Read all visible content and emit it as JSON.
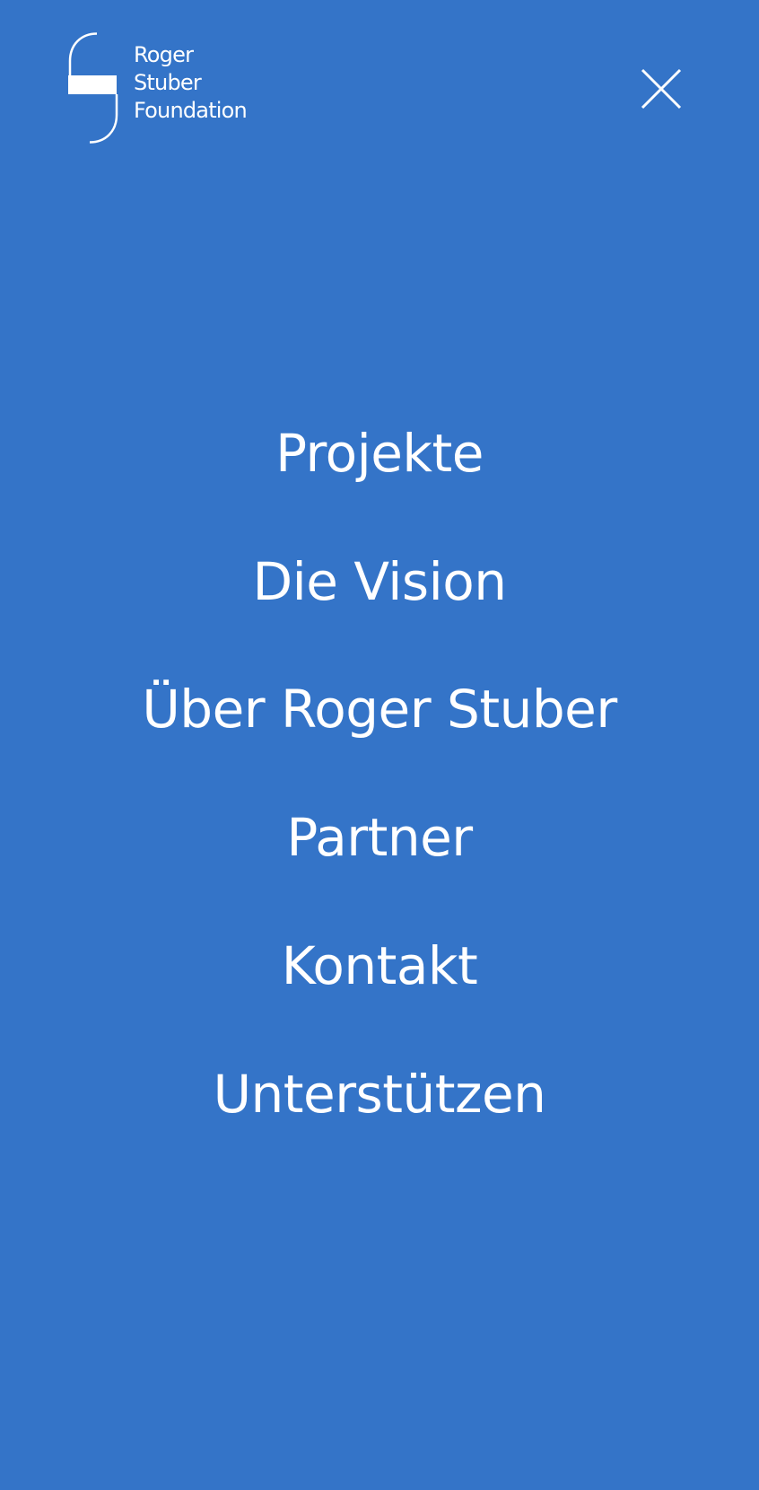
{
  "theme": {
    "background": "#3474c8",
    "foreground": "#ffffff"
  },
  "header": {
    "logo": {
      "line1": "Roger",
      "line2": "Stuber",
      "line3": "Foundation",
      "icon": "foundation-s-mark-icon"
    },
    "close": {
      "icon": "close-icon",
      "label": ""
    }
  },
  "menu": {
    "items": [
      {
        "label": "Projekte"
      },
      {
        "label": "Die Vision"
      },
      {
        "label": "Über Roger Stuber"
      },
      {
        "label": "Partner"
      },
      {
        "label": "Kontakt"
      },
      {
        "label": "Unterstützen"
      }
    ]
  }
}
